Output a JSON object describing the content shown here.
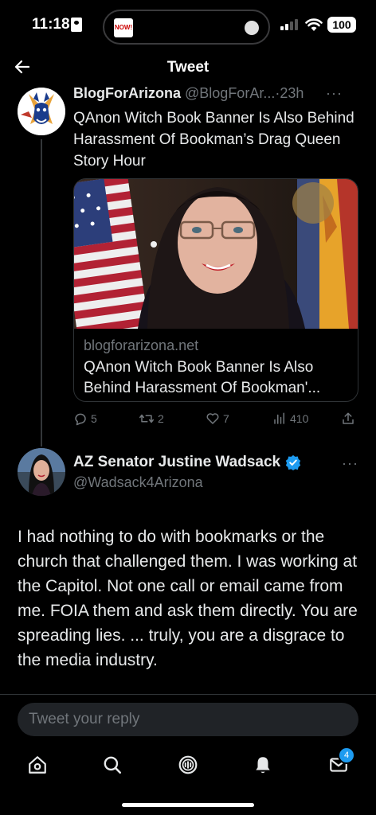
{
  "status_bar": {
    "time": "11:18",
    "island_app_label": "NOW!",
    "battery": "100"
  },
  "header": {
    "title": "Tweet",
    "back_icon": "arrow-left-icon"
  },
  "tweet1": {
    "display_name": "BlogForArizona",
    "handle": "@BlogForAr...",
    "time": "·23h",
    "more": "···",
    "text": "QAnon Witch Book Banner Is Also Behind Harassment Of Bookman’s Drag Queen Story Hour",
    "card": {
      "domain": "blogforarizona.net",
      "title": "QAnon Witch Book Banner Is Also Behind Harassment Of Bookman'..."
    },
    "actions": {
      "replies": "5",
      "retweets": "2",
      "likes": "7",
      "views": "410"
    }
  },
  "tweet2": {
    "display_name": "AZ Senator Justine Wadsack",
    "handle": "@Wadsack4Arizona",
    "more": "···",
    "text": "I had nothing to do with bookmarks or the church that challenged them. I was working at the Capitol. Not one call or email came from me. FOIA them and ask them directly. You are spreading lies. ... truly, you are a disgrace to the media industry."
  },
  "reply": {
    "placeholder": "Tweet your reply"
  },
  "nav": {
    "items": [
      "home-icon",
      "search-icon",
      "spaces-icon",
      "notifications-icon",
      "messages-icon"
    ],
    "messages_badge": "4"
  },
  "colors": {
    "background": "#000000",
    "text": "#e7e9ea",
    "secondary": "#71767b",
    "accent": "#1d9bf0",
    "divider": "#2f3336"
  }
}
